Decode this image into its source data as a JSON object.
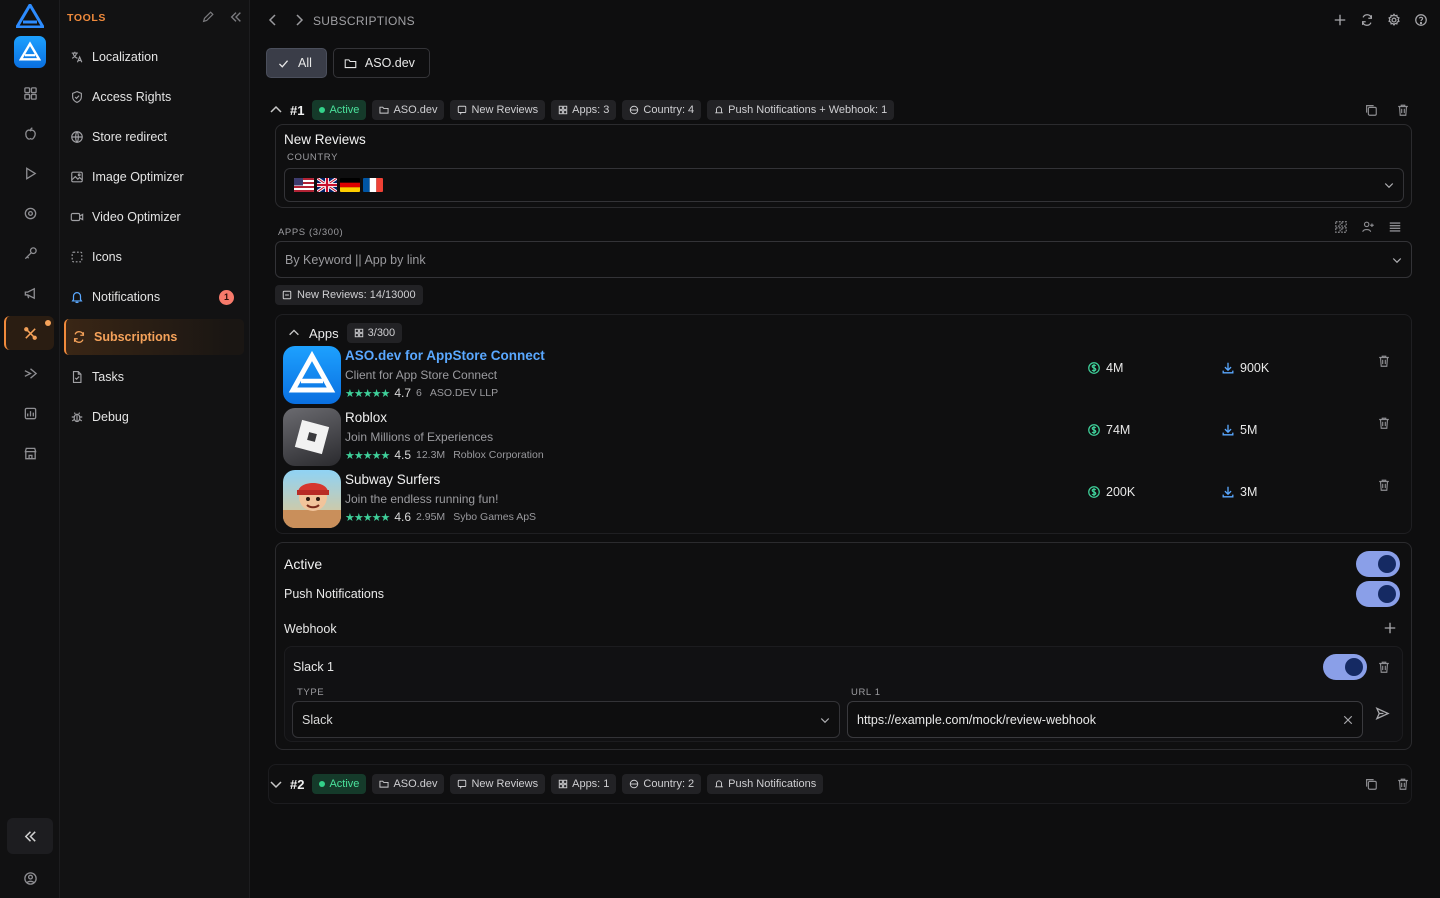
{
  "sidebar": {
    "title": "TOOLS",
    "items": [
      {
        "label": "Localization",
        "icon": "translate-icon"
      },
      {
        "label": "Access Rights",
        "icon": "shield-icon"
      },
      {
        "label": "Store redirect",
        "icon": "globe-icon"
      },
      {
        "label": "Image Optimizer",
        "icon": "image-icon"
      },
      {
        "label": "Video Optimizer",
        "icon": "video-icon"
      },
      {
        "label": "Icons",
        "icon": "frame-icon"
      },
      {
        "label": "Notifications",
        "icon": "bell-icon",
        "badge": "1"
      },
      {
        "label": "Subscriptions",
        "icon": "refresh-icon",
        "active": true
      },
      {
        "label": "Tasks",
        "icon": "document-icon"
      },
      {
        "label": "Debug",
        "icon": "bug-icon"
      }
    ]
  },
  "header": {
    "breadcrumb": "SUBSCRIPTIONS"
  },
  "filters": {
    "all": "All",
    "workspace": "ASO.dev"
  },
  "subscriptions": [
    {
      "number": "#1",
      "status": "Active",
      "pills": [
        "ASO.dev",
        "New Reviews",
        "Apps: 3",
        "Country: 4",
        "Push Notifications + Webhook: 1"
      ],
      "trigger_title": "New Reviews",
      "country_label": "COUNTRY",
      "countries": [
        "us",
        "gb",
        "de",
        "fr"
      ],
      "apps_label": "APPS (3/300)",
      "apps_placeholder": "By Keyword || App by link",
      "reviews_usage": "New Reviews: 14/13000",
      "apps_section": {
        "title": "Apps",
        "count": "3/300"
      },
      "apps": [
        {
          "name": "ASO.dev for AppStore Connect",
          "subtitle": "Client for App Store Connect",
          "rating": "4.7",
          "reviews": "6",
          "developer": "ASO.DEV LLP",
          "revenue": "4M",
          "downloads": "900K"
        },
        {
          "name": "Roblox",
          "subtitle": "Join Millions of Experiences",
          "rating": "4.5",
          "reviews": "12.3M",
          "developer": "Roblox Corporation",
          "revenue": "74M",
          "downloads": "5M"
        },
        {
          "name": "Subway Surfers",
          "subtitle": "Join the endless running fun!",
          "rating": "4.6",
          "reviews": "2.95M",
          "developer": "Sybo Games ApS",
          "revenue": "200K",
          "downloads": "3M"
        }
      ],
      "settings": {
        "active_label": "Active",
        "push_label": "Push Notifications",
        "webhook_label": "Webhook",
        "webhook": {
          "name": "Slack 1",
          "type_label": "TYPE",
          "type_value": "Slack",
          "url_label": "URL 1",
          "url_value": "https://example.com/mock/review-webhook"
        }
      }
    },
    {
      "number": "#2",
      "status": "Active",
      "pills": [
        "ASO.dev",
        "New Reviews",
        "Apps: 1",
        "Country: 2",
        "Push Notifications"
      ]
    }
  ],
  "colors": {
    "accent": "#f08a3c",
    "active_green": "#4be29c",
    "link_blue": "#5aa8ff",
    "toggle_on": "#8a9fe8"
  }
}
